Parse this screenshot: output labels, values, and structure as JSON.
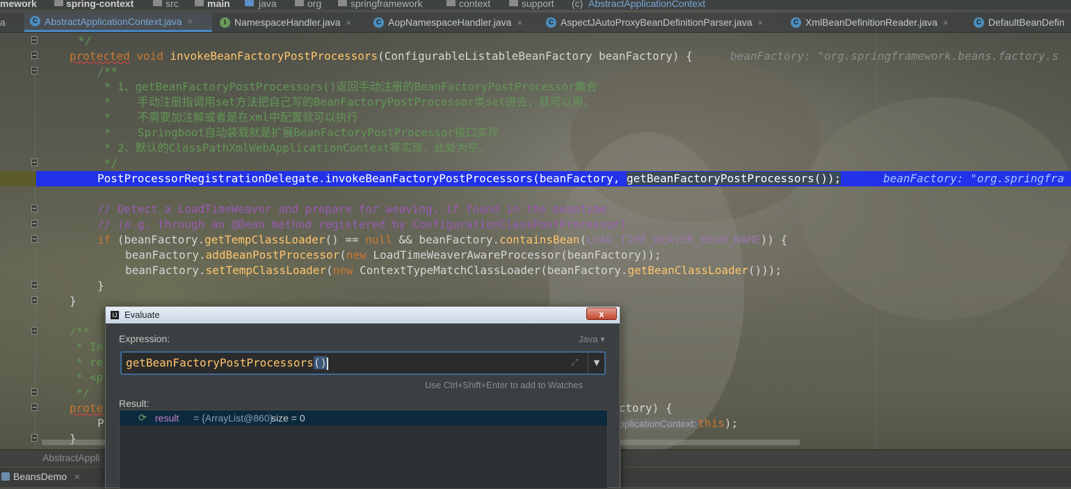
{
  "breadcrumb": {
    "items": [
      "mework",
      "spring-context",
      "src",
      "main",
      "java",
      "org",
      "springframework",
      "context",
      "support",
      "AbstractApplicationContext"
    ]
  },
  "tabs": [
    {
      "label": "AbstractApplicationContext.java",
      "icon": "class-icon",
      "active": true,
      "prefix": "a"
    },
    {
      "label": "NamespaceHandler.java",
      "icon": "interface-icon"
    },
    {
      "label": "AopNamespaceHandler.java",
      "icon": "class-icon"
    },
    {
      "label": "AspectJAutoProxyBeanDefinitionParser.java",
      "icon": "class-icon"
    },
    {
      "label": "XmlBeanDefinitionReader.java",
      "icon": "class-icon"
    },
    {
      "label": "DefaultBeanDefin",
      "icon": "class-icon"
    }
  ],
  "tab_close_glyph": "×",
  "code": {
    "l_docend": "*/",
    "l_sig_kw1": "protected",
    "l_sig_kw2": "void",
    "l_sig_fn": "invokeBeanFactoryPostProcessors",
    "l_sig_rest": "(ConfigurableListableBeanFactory beanFactory) {",
    "l_sig_hint": "beanFactory: \"org.springframework.beans.factory.s",
    "doc_open": "/**",
    "doc1": " * 1、getBeanFactoryPostProcessors()返回手动注册的BeanFactoryPostProcessor集合",
    "doc2": " *    手动注册指调用set方法把自己写的BeanFactoryPostProcessor类set进去，就可以用。",
    "doc3": " *    不需要加注解或者是在xml中配置就可以执行",
    "doc4": " *    Springboot自动装载就是扩展BeanFactoryPostProcessor接口实现",
    "doc5": " * 2、默认的ClassPathXmlWebApplicationContext等实现，此处为空。",
    "doc6": " */",
    "exec_a": "PostProcessorRegistrationDelegate.invokeBeanFactoryPostProcessors(beanFactory, ",
    "exec_b": "getBeanFactoryPostProcessors());",
    "exec_hint": "beanFactory: \"org.springfra",
    "c1": "// Detect a LoadTimeWeaver and prepare for weaving, if found in the meantime",
    "c2": "// (e.g. through an @Bean method registered by ConfigurationClassPostProcessor)",
    "if_kw": "if",
    "if_a": " (beanFactory.",
    "if_fn1": "getTempClassLoader",
    "if_b": "() == ",
    "if_null": "null",
    "if_c": " && beanFactory.",
    "if_fn2": "containsBean",
    "if_d": "(",
    "if_const": "LOAD_TIME_WEAVER_BEAN_NAME",
    "if_e": ")) {",
    "add_a": "beanFactory.",
    "add_fn": "addBeanPostProcessor",
    "add_b": "(",
    "add_new": "new",
    "add_c": " LoadTimeWeaverAwareProcessor(beanFactory));",
    "set_a": "beanFactory.",
    "set_fn": "setTempClassLoader",
    "set_b": "(",
    "set_new": "new",
    "set_c": " ContextTypeMatchClassLoader(beanFactory.",
    "set_fn2": "getBeanClassLoader",
    "set_d": "()));",
    "close1": "}",
    "close2": "}",
    "jd_open": "/**",
    "jd1": " * In",
    "jd2": " * re",
    "jd3": " * <p",
    "jd4": " */",
    "prote": "prote",
    "p_tail": "actory) {",
    "pl_p": "P",
    "pl_hint": "pplicationContext:",
    "pl_this": "this",
    "pl_end": ");",
    "close3": "}"
  },
  "bottom": {
    "editor_breadcrumb": "AbstractAppli",
    "run_tab": "BeansDemo"
  },
  "dialog": {
    "title": "Evaluate",
    "close_glyph": "x",
    "expression_label": "Expression:",
    "language": "Java",
    "expression_text": "getBeanFactoryPostProcessors",
    "expression_paren": "()",
    "watches_hint": "Use Ctrl+Shift+Enter to add to Watches",
    "result_label": "Result:",
    "result_name": "result",
    "result_value": "= {ArrayList@860}",
    "result_size": "size = 0"
  },
  "colors": {
    "keyword": "#cc7832",
    "method": "#ffc66d",
    "javadoc": "#629755",
    "comment": "#9b59b6",
    "execution_line": "#2132e8",
    "dialog_bg": "#3c3f41"
  }
}
